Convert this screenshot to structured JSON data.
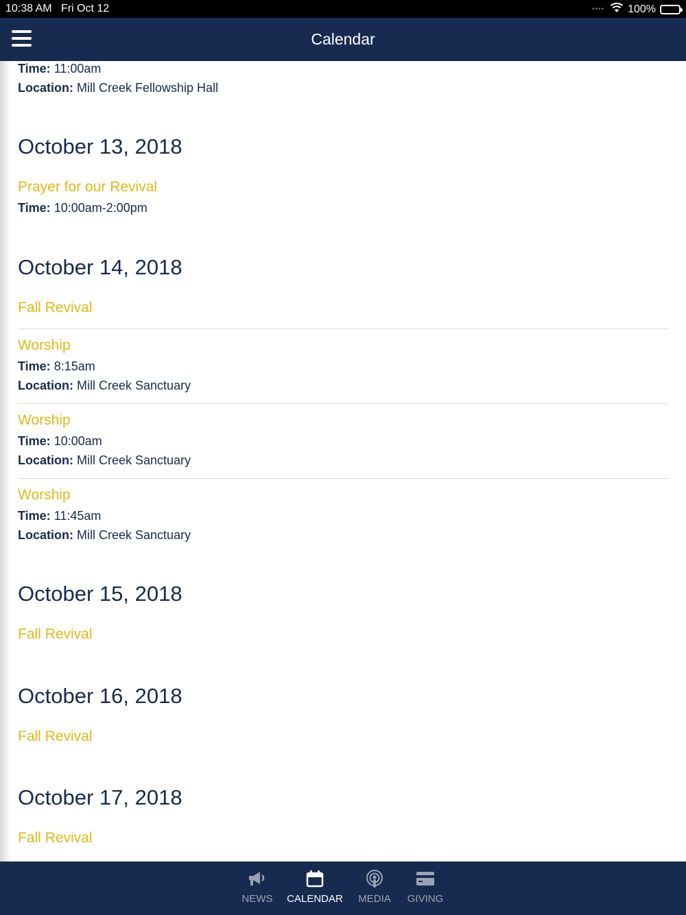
{
  "status_bar": {
    "time": "10:38 AM",
    "date": "Fri Oct 12",
    "battery": "100%"
  },
  "nav": {
    "title": "Calendar"
  },
  "content": {
    "top_event": {
      "time_label": "Time:",
      "time": "11:00am",
      "location_label": "Location:",
      "location": "Mill Creek Fellowship Hall"
    },
    "days": [
      {
        "date": "October 13, 2018",
        "events": [
          {
            "title": "Prayer for our Revival",
            "time_label": "Time:",
            "time": "10:00am-2:00pm"
          }
        ]
      },
      {
        "date": "October 14, 2018",
        "events": [
          {
            "title": "Fall Revival"
          },
          {
            "title": "Worship",
            "time_label": "Time:",
            "time": "8:15am",
            "location_label": "Location:",
            "location": "Mill Creek Sanctuary"
          },
          {
            "title": "Worship",
            "time_label": "Time:",
            "time": "10:00am",
            "location_label": "Location:",
            "location": "Mill Creek Sanctuary"
          },
          {
            "title": "Worship",
            "time_label": "Time:",
            "time": "11:45am",
            "location_label": "Location:",
            "location": "Mill Creek Sanctuary"
          }
        ]
      },
      {
        "date": "October 15, 2018",
        "events": [
          {
            "title": "Fall Revival"
          }
        ]
      },
      {
        "date": "October 16, 2018",
        "events": [
          {
            "title": "Fall Revival"
          }
        ]
      },
      {
        "date": "October 17, 2018",
        "events": [
          {
            "title": "Fall Revival"
          }
        ]
      }
    ]
  },
  "tabs": [
    {
      "label": "NEWS",
      "icon": "megaphone-icon",
      "active": false
    },
    {
      "label": "CALENDAR",
      "icon": "calendar-icon",
      "active": true
    },
    {
      "label": "MEDIA",
      "icon": "podcast-icon",
      "active": false
    },
    {
      "label": "GIVING",
      "icon": "credit-card-icon",
      "active": false
    }
  ],
  "colors": {
    "navy": "#172a4f",
    "gold": "#e3b814"
  }
}
